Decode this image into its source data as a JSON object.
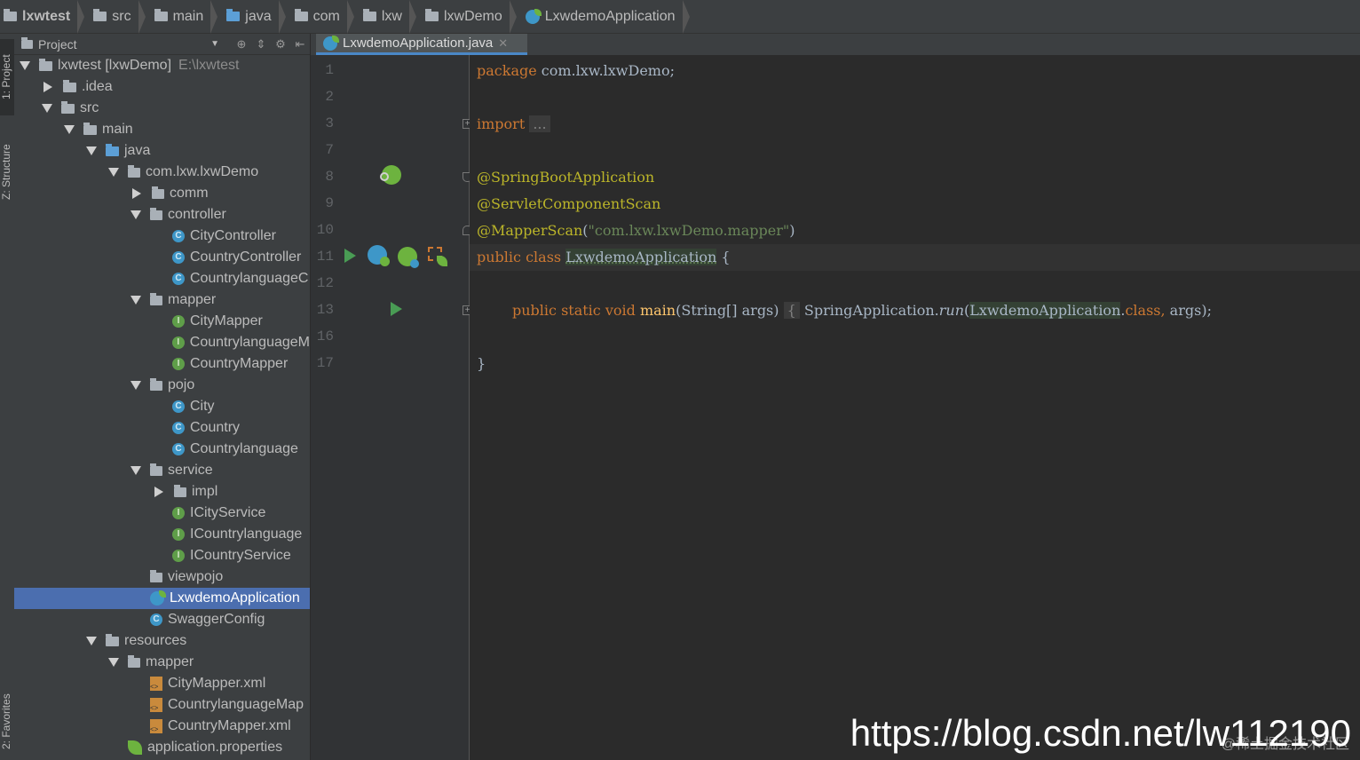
{
  "breadcrumbs": [
    "lxwtest",
    "src",
    "main",
    "java",
    "com",
    "lxw",
    "lxwDemo",
    "LxwdemoApplication"
  ],
  "tool_strip": {
    "project_tab": "1: Project",
    "structure_tab": "Z: Structure",
    "favorites_tab": "2: Favorites"
  },
  "project_panel": {
    "title": "Project",
    "tree": [
      {
        "label": "lxwtest [lxwDemo]",
        "path": "E:\\lxwtest",
        "icon": "module-folder-icon",
        "state": "expanded"
      },
      {
        "label": ".idea",
        "icon": "folder-icon",
        "state": "collapsed"
      },
      {
        "label": "src",
        "icon": "folder-icon",
        "state": "expanded"
      },
      {
        "label": "main",
        "icon": "folder-icon",
        "state": "expanded"
      },
      {
        "label": "java",
        "icon": "source-folder-icon",
        "state": "expanded"
      },
      {
        "label": "com.lxw.lxwDemo",
        "icon": "package-icon",
        "state": "expanded"
      },
      {
        "label": "comm",
        "icon": "package-icon",
        "state": "collapsed"
      },
      {
        "label": "controller",
        "icon": "package-icon",
        "state": "expanded"
      },
      {
        "label": "CityController",
        "icon": "class-icon",
        "state": "leaf"
      },
      {
        "label": "CountryController",
        "icon": "class-icon",
        "state": "leaf"
      },
      {
        "label": "CountrylanguageC",
        "icon": "class-icon",
        "state": "leaf"
      },
      {
        "label": "mapper",
        "icon": "package-icon",
        "state": "expanded"
      },
      {
        "label": "CityMapper",
        "icon": "interface-icon",
        "state": "leaf"
      },
      {
        "label": "CountrylanguageM",
        "icon": "interface-icon",
        "state": "leaf"
      },
      {
        "label": "CountryMapper",
        "icon": "interface-icon",
        "state": "leaf"
      },
      {
        "label": "pojo",
        "icon": "package-icon",
        "state": "expanded"
      },
      {
        "label": "City",
        "icon": "class-icon",
        "state": "leaf"
      },
      {
        "label": "Country",
        "icon": "class-icon",
        "state": "leaf"
      },
      {
        "label": "Countrylanguage",
        "icon": "class-icon",
        "state": "leaf"
      },
      {
        "label": "service",
        "icon": "package-icon",
        "state": "expanded"
      },
      {
        "label": "impl",
        "icon": "package-icon",
        "state": "collapsed"
      },
      {
        "label": "ICityService",
        "icon": "interface-icon",
        "state": "leaf"
      },
      {
        "label": "ICountrylanguage",
        "icon": "interface-icon",
        "state": "leaf"
      },
      {
        "label": "ICountryService",
        "icon": "interface-icon",
        "state": "leaf"
      },
      {
        "label": "viewpojo",
        "icon": "package-icon",
        "state": "leaf"
      },
      {
        "label": "LxwdemoApplication",
        "icon": "spring-boot-class-icon",
        "state": "leaf",
        "selected": true
      },
      {
        "label": "SwaggerConfig",
        "icon": "class-icon",
        "state": "leaf"
      },
      {
        "label": "resources",
        "icon": "resources-folder-icon",
        "state": "expanded"
      },
      {
        "label": "mapper",
        "icon": "package-icon",
        "state": "expanded"
      },
      {
        "label": "CityMapper.xml",
        "icon": "xml-file-icon",
        "state": "leaf"
      },
      {
        "label": "CountrylanguageMap",
        "icon": "xml-file-icon",
        "state": "leaf"
      },
      {
        "label": "CountryMapper.xml",
        "icon": "xml-file-icon",
        "state": "leaf"
      },
      {
        "label": "application.properties",
        "icon": "properties-file-icon",
        "state": "leaf"
      }
    ]
  },
  "editor": {
    "tab_label": "LxwdemoApplication.java",
    "line_numbers": [
      "1",
      "2",
      "3",
      "7",
      "8",
      "9",
      "10",
      "11",
      "12",
      "13",
      "16",
      "17"
    ],
    "code": {
      "l1_kw": "package",
      "l1_rest": " com.lxw.lxwDemo;",
      "l3_kw": "import",
      "l3_fold": "...",
      "l8": "@SpringBootApplication",
      "l9": "@ServletComponentScan",
      "l10_ann": "@MapperScan",
      "l10_open": "(",
      "l10_str": "\"com.lxw.lxwDemo.mapper\"",
      "l10_close": ")",
      "l11_kw": "public class ",
      "l11_cls": "LxwdemoApplication",
      "l11_rest": " {",
      "l13_kw": "public static void ",
      "l13_name": "main",
      "l13_params": "(String[] args) ",
      "l13_brace": "{",
      "l13_call": " SpringApplication.",
      "l13_run": "run",
      "l13_open": "(",
      "l13_cls": "LxwdemoApplication",
      "l13_dot": ".",
      "l13_kw2": "class,",
      "l13_end": " args);",
      "l17": "}"
    }
  },
  "watermark": {
    "url": "https://blog.csdn.net/lw112190",
    "sub": "@稀土掘金技术社区"
  },
  "colors": {
    "keyword": "#cc7832",
    "annotation": "#bbb529",
    "string": "#6a8759",
    "selection": "#4b6eaf"
  }
}
